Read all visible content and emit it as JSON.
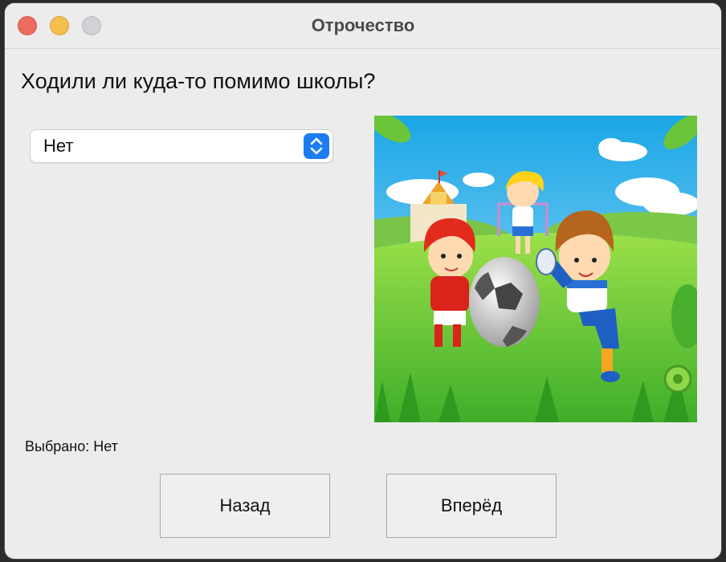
{
  "window": {
    "title": "Отрочество"
  },
  "question": "Ходили ли куда-то помимо школы?",
  "dropdown": {
    "selected": "Нет",
    "icon": "chevron-up-down-icon"
  },
  "illustration": {
    "description_icon": "kids-playing-football-illustration"
  },
  "selection_status": "Выбрано: Нет",
  "buttons": {
    "back": "Назад",
    "next": "Вперёд"
  },
  "colors": {
    "accent": "#1e7cf2",
    "close": "#ed6a5e",
    "minimize": "#f4bf4f",
    "zoom": "#d3d1d6"
  }
}
